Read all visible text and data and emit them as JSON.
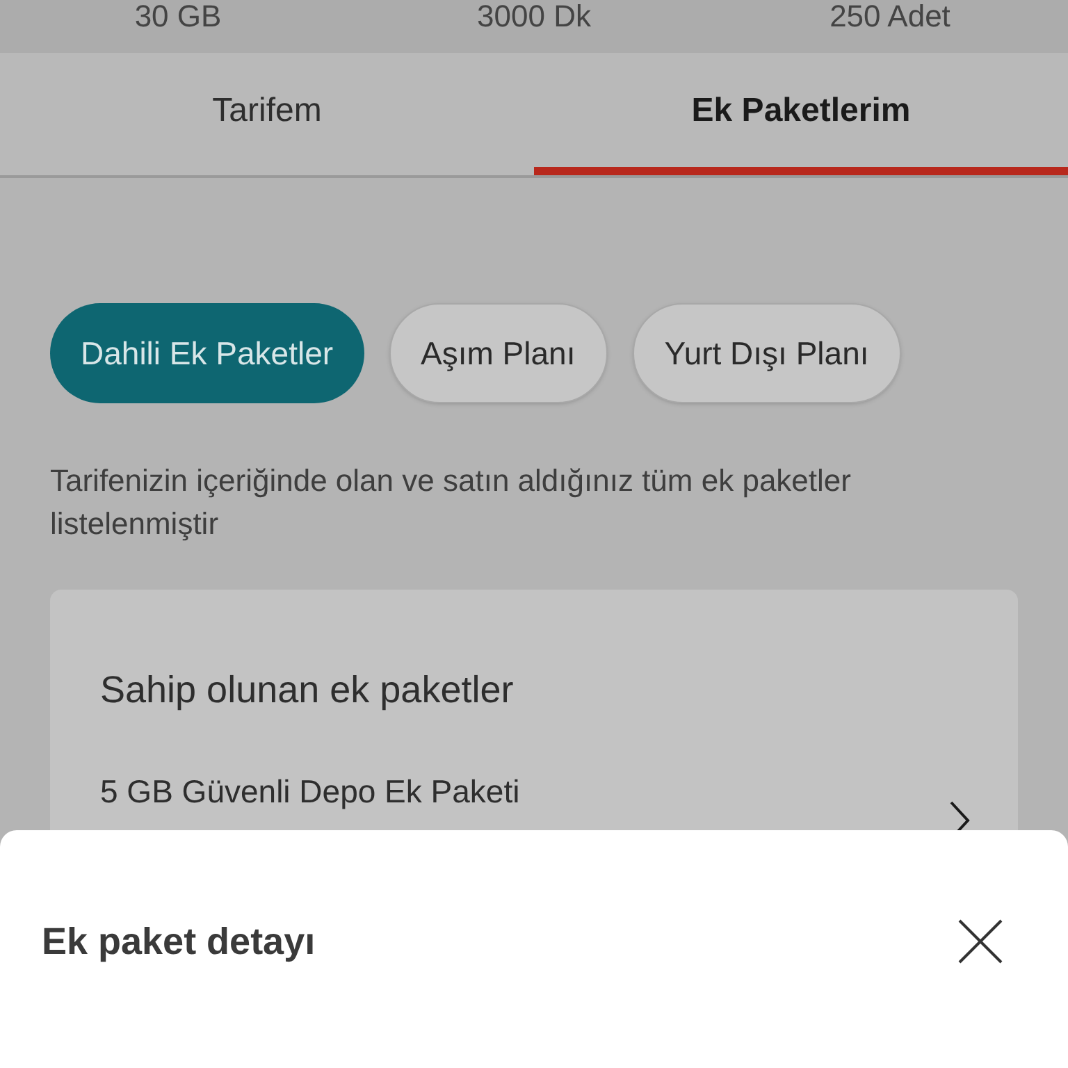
{
  "summary": [
    "30 GB",
    "3000 Dk",
    "250 Adet"
  ],
  "tabs": [
    {
      "label": "Tarifem",
      "selected": false
    },
    {
      "label": "Ek Paketlerim",
      "selected": true
    }
  ],
  "chips": [
    {
      "label": "Dahili Ek Paketler",
      "selected": true
    },
    {
      "label": "Aşım Planı",
      "selected": false
    },
    {
      "label": "Yurt Dışı Planı",
      "selected": false
    }
  ],
  "description": "Tarifenizin içeriğinde olan ve satın aldığınız tüm ek paketler listelenmiştir",
  "card": {
    "title": "Sahip olunan ek paketler",
    "items": [
      "5 GB Güvenli Depo Ek Paketi"
    ]
  },
  "sheet": {
    "title": "Ek paket detayı"
  }
}
